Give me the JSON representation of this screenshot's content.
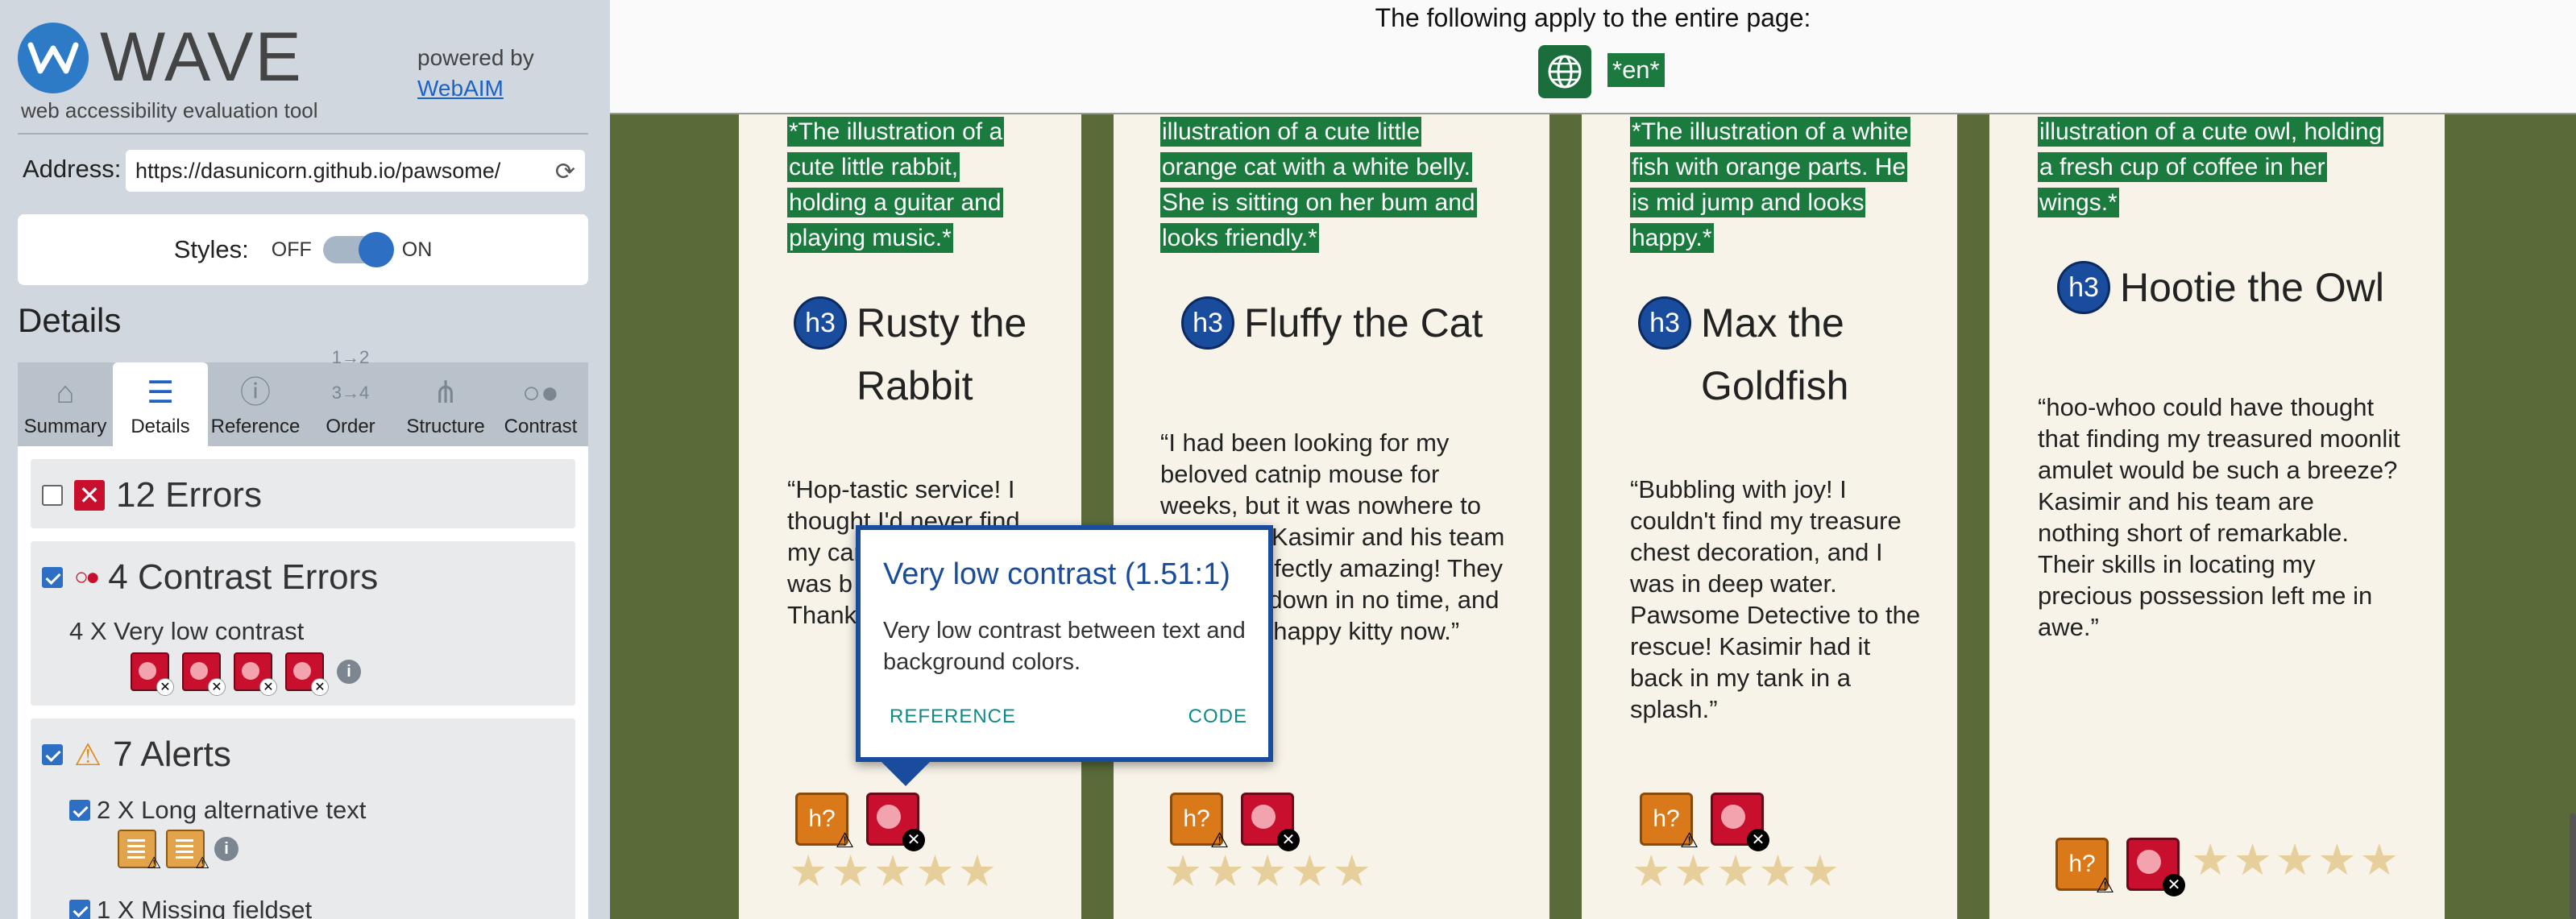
{
  "wave": {
    "logo_text": "WAVE",
    "tagline": "web accessibility evaluation tool",
    "powered_by": "powered by",
    "webaim": "WebAIM",
    "address_label": "Address:",
    "address_value": "https://dasunicorn.github.io/pawsome/",
    "styles_label": "Styles:",
    "styles_off": "OFF",
    "styles_on": "ON",
    "details_heading": "Details",
    "tabs": [
      {
        "label": "Summary",
        "icon": "home-icon"
      },
      {
        "label": "Details",
        "icon": "list-icon"
      },
      {
        "label": "Reference",
        "icon": "info-icon"
      },
      {
        "label": "Order",
        "icon": "order-icon"
      },
      {
        "label": "Structure",
        "icon": "structure-icon"
      },
      {
        "label": "Contrast",
        "icon": "contrast-icon"
      }
    ],
    "active_tab": "Details",
    "errors": {
      "title": "12 Errors",
      "checked": false
    },
    "contrast": {
      "title": "4 Contrast Errors",
      "checked": true,
      "sub": "4 X Very low contrast",
      "count": 4
    },
    "alerts": {
      "title": "7 Alerts",
      "checked": true,
      "items": [
        "2 X Long alternative text",
        "1 X Missing fieldset"
      ]
    }
  },
  "page": {
    "apply_text": "The following apply to the entire page:",
    "lang_badge": "*en*",
    "cards": [
      {
        "alt_text": "*The illustration of a cute little rabbit, holding a guitar and playing music.*",
        "heading_badge": "h3",
        "heading": "Rusty the Rabbit",
        "quote": "“Hop-tastic service! I thought I'd never find my carrot… Kasim… was b… paws… Thank… Detec…"
      },
      {
        "alt_text": "illustration of a cute little orange cat with a white belly. She is sitting on her bum and looks friendly.*",
        "heading_badge": "h3",
        "heading": "Fluffy the Cat",
        "quote": "“I had been looking for my beloved catnip mouse for weeks, but it was nowhere to be found. Kasimir and his team were purr-fectly amazing! They tracked it down in no time, and I'm now a happy kitty now.”"
      },
      {
        "alt_text": "*The illustration of a white fish with orange parts. He is mid jump and looks happy.*",
        "heading_badge": "h3",
        "heading": "Max the Goldfish",
        "quote": "“Bubbling with joy! I couldn't find my treasure chest decoration, and I was in deep water. Pawsome Detective to the rescue! Kasimir had it back in my tank in a splash.”"
      },
      {
        "alt_text": "illustration of a cute owl, holding a fresh cup of coffee in her wings.*",
        "heading_badge": "h3",
        "heading": "Hootie the Owl",
        "quote": "“hoo-whoo could have thought that finding my treasured moonlit amulet would be such a breeze? Kasimir and his team are nothing short of remarkable. Their skills in locating my precious possession left me in awe.”"
      }
    ],
    "icon_alert": "h?",
    "stars": "★★★★★"
  },
  "tooltip": {
    "title": "Very low contrast (1.51:1)",
    "body": "Very low contrast between text and background colors.",
    "reference": "REFERENCE",
    "code": "CODE"
  },
  "colors": {
    "wave_blue": "#1a4c9e",
    "alt_green": "#1b7a3e",
    "error_red": "#c8102e",
    "alert_orange": "#d9791a",
    "page_bg": "#5a6b3a"
  }
}
